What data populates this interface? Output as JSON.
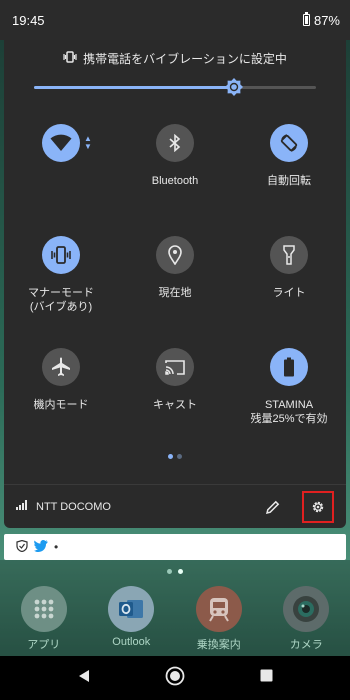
{
  "status_bar": {
    "time": "19:45",
    "battery": "87%"
  },
  "panel": {
    "vibrate_text": "携帯電話をバイブレーションに設定中",
    "brightness_level": 0.71,
    "tiles": [
      {
        "label": "",
        "icon": "wifi-icon",
        "state": "on"
      },
      {
        "label": "Bluetooth",
        "icon": "bluetooth-icon",
        "state": "off"
      },
      {
        "label": "自動回転",
        "icon": "auto-rotate-icon",
        "state": "on"
      },
      {
        "label": "マナーモード\n(バイブあり)",
        "icon": "vibrate-icon",
        "state": "on"
      },
      {
        "label": "現在地",
        "icon": "location-icon",
        "state": "off"
      },
      {
        "label": "ライト",
        "icon": "flashlight-icon",
        "state": "off"
      },
      {
        "label": "機内モード",
        "icon": "airplane-icon",
        "state": "off"
      },
      {
        "label": "キャスト",
        "icon": "cast-icon",
        "state": "off"
      },
      {
        "label": "STAMINA\n残量25%で有効",
        "icon": "battery-saver-icon",
        "state": "on"
      }
    ],
    "carrier": "NTT DOCOMO"
  },
  "notification": {
    "text": "•"
  },
  "dock": [
    {
      "label": "アプリ",
      "icon": "apps-icon"
    },
    {
      "label": "Outlook",
      "icon": "outlook-icon"
    },
    {
      "label": "乗換案内",
      "icon": "train-icon"
    },
    {
      "label": "カメラ",
      "icon": "camera-icon"
    }
  ],
  "colors": {
    "accent": "#8ab4f8",
    "panel": "#2a2a2a",
    "highlight": "#e02020"
  }
}
